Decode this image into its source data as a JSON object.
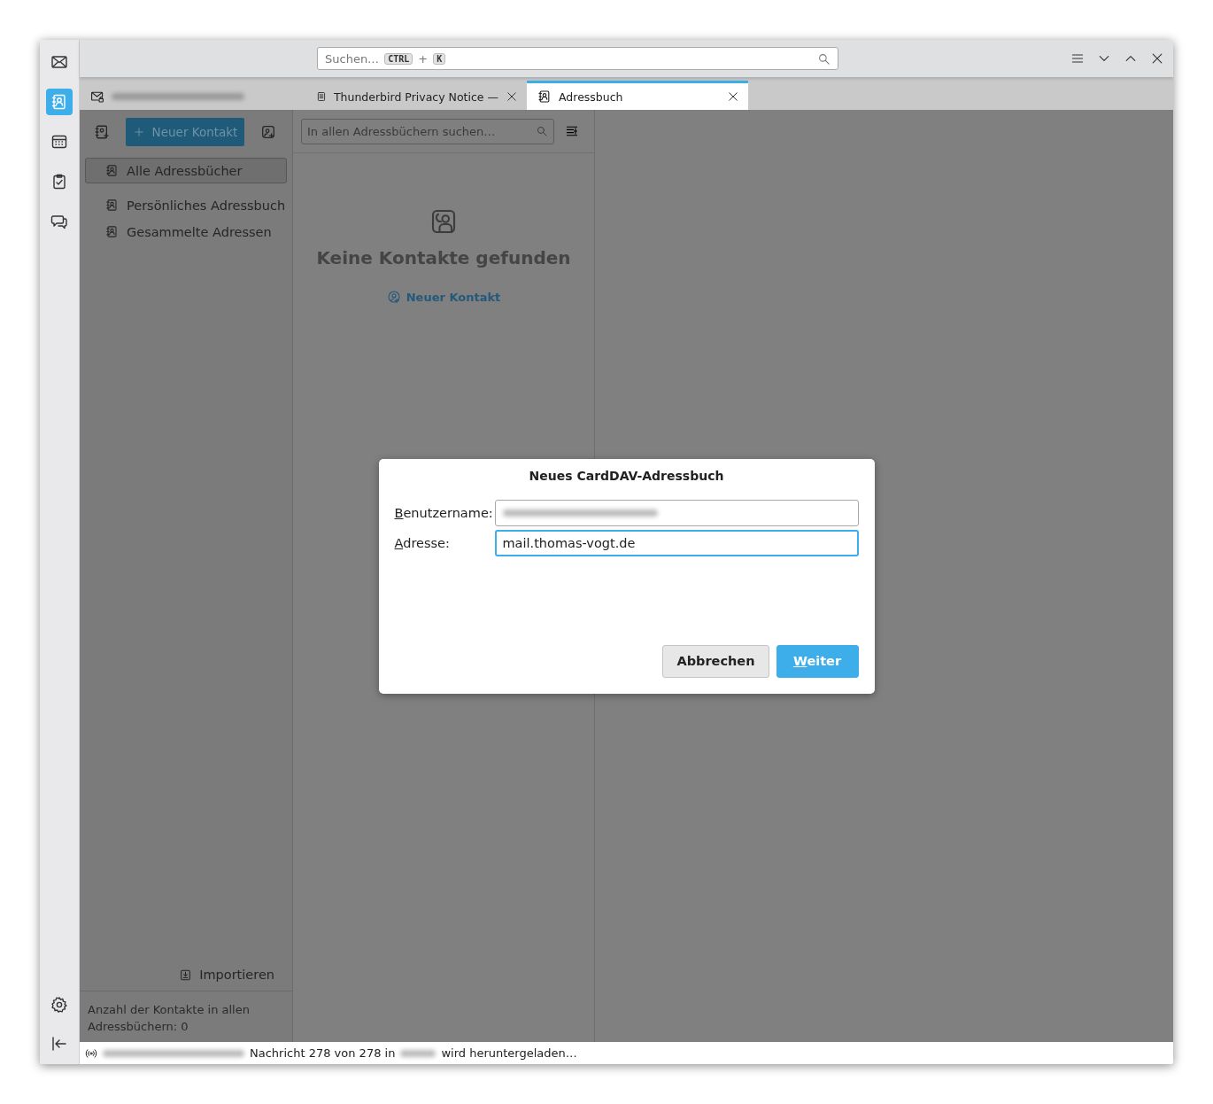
{
  "spaces_toolbar": {
    "items": [
      {
        "kind": "mail",
        "selected": false
      },
      {
        "kind": "addressbook",
        "selected": true
      },
      {
        "kind": "calendar",
        "selected": false
      },
      {
        "kind": "tasks",
        "selected": false
      },
      {
        "kind": "chat",
        "selected": false
      }
    ],
    "bottom": [
      {
        "kind": "settings"
      },
      {
        "kind": "collapse"
      }
    ]
  },
  "search": {
    "placeholder": "Suchen…",
    "shortcut": [
      "CTRL",
      "K"
    ],
    "joiner": "+"
  },
  "tabs": [
    {
      "kind": "mail",
      "selected": false,
      "closable": false
    },
    {
      "kind": "document",
      "label": "Thunderbird Privacy Notice —",
      "selected": false,
      "closable": true
    },
    {
      "kind": "addressbook",
      "label": "Adressbuch",
      "selected": true,
      "closable": true
    }
  ],
  "sidebar": {
    "new_contact_button": "Neuer Kontakt",
    "books": [
      {
        "label": "Alle Adressbücher",
        "selected": true
      },
      {
        "label": "Persönliches Adressbuch",
        "selected": false
      },
      {
        "label": "Gesammelte Adressen",
        "selected": false
      }
    ],
    "import_button": "Importieren",
    "footer": "Anzahl der Kontakte in allen Adressbüchern: 0"
  },
  "list": {
    "search_placeholder": "In allen Adressbüchern suchen…",
    "empty_title": "Keine Kontakte gefunden",
    "empty_link": "Neuer Kontakt"
  },
  "dialog": {
    "title": "Neues CardDAV-Adressbuch",
    "fields": [
      {
        "label": "Benutzername:",
        "mnemonic_underlined": true,
        "focused": false
      },
      {
        "label": "Adresse:",
        "mnemonic_underlined": true,
        "value": "mail.thomas-vogt.de",
        "focused": true
      }
    ],
    "buttons": [
      {
        "label": "Abbrechen",
        "kind": "secondary"
      },
      {
        "label": "Weiter",
        "kind": "primary",
        "mnemonic_underlined": true
      }
    ]
  },
  "status_bar": {
    "texts": [
      "Nachricht 278 von 278 in",
      "wird heruntergeladen…"
    ]
  }
}
